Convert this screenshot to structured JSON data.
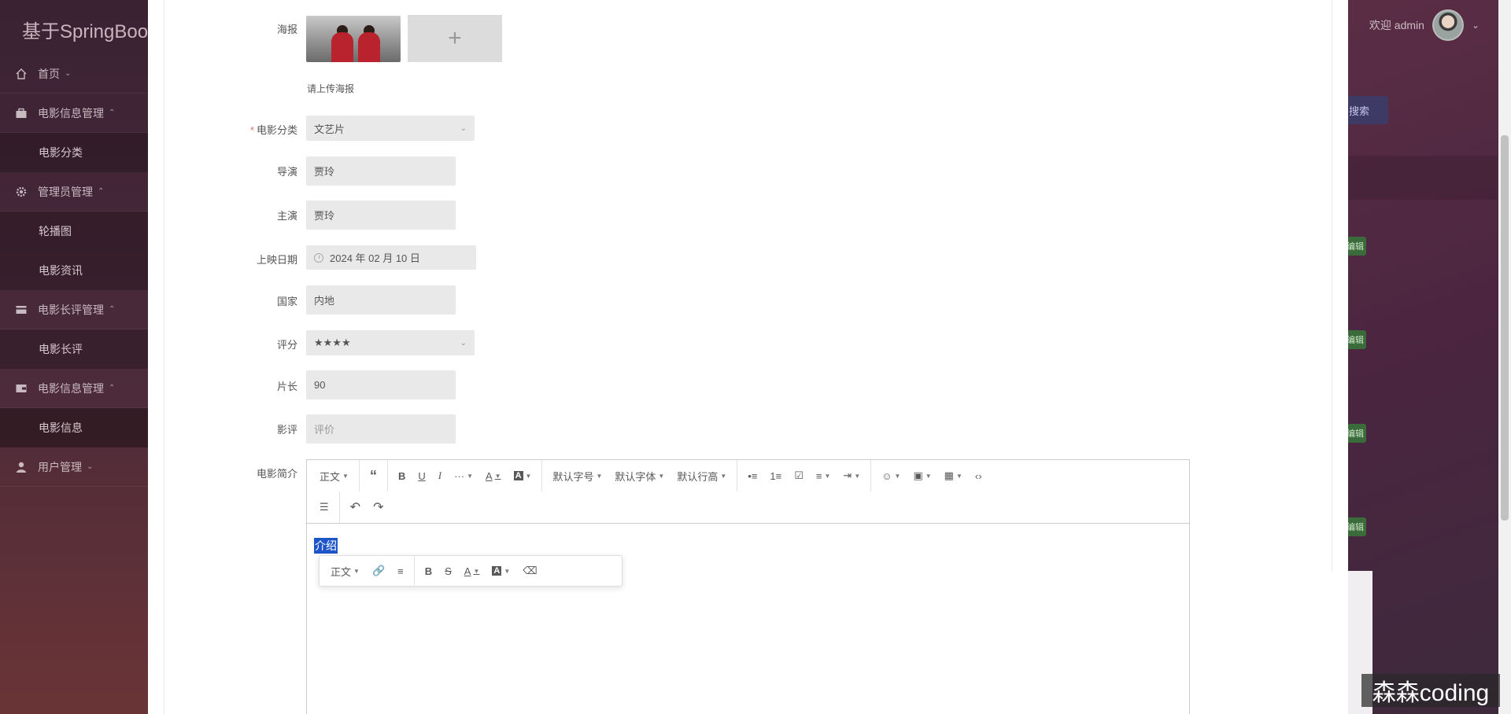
{
  "app": {
    "brand": "基于SpringBoo",
    "welcome": "欢迎 admin",
    "search_btn": "搜索",
    "tag_label": "编辑"
  },
  "sidebar": {
    "items": [
      {
        "label": "首页",
        "icon": "home-icon"
      },
      {
        "label": "电影信息管理",
        "icon": "briefcase-icon"
      },
      {
        "label": "电影分类",
        "sub": true
      },
      {
        "label": "管理员管理",
        "icon": "gear-icon"
      },
      {
        "label": "轮播图",
        "sub": true
      },
      {
        "label": "电影资讯",
        "sub": true
      },
      {
        "label": "电影长评管理",
        "icon": "card-icon"
      },
      {
        "label": "电影长评",
        "sub": true
      },
      {
        "label": "电影信息管理",
        "icon": "wallet-icon"
      },
      {
        "label": "电影信息",
        "sub": true,
        "active": true
      },
      {
        "label": "用户管理",
        "icon": "user-icon"
      }
    ]
  },
  "form": {
    "poster": {
      "label": "海报",
      "hint": "请上传海报",
      "add": "+"
    },
    "category": {
      "label": "电影分类",
      "value": "文艺片",
      "required": true
    },
    "director": {
      "label": "导演",
      "value": "贾玲"
    },
    "lead": {
      "label": "主演",
      "value": "贾玲"
    },
    "release": {
      "label": "上映日期",
      "value": "2024 年 02 月 10 日"
    },
    "country": {
      "label": "国家",
      "value": "内地"
    },
    "rating": {
      "label": "评分",
      "value": "★★★★"
    },
    "duration": {
      "label": "片长",
      "value": "90"
    },
    "review": {
      "label": "影评",
      "placeholder": "评价"
    },
    "intro": {
      "label": "电影简介"
    }
  },
  "editor": {
    "toolbar_row1": [
      "正文",
      "“",
      "B",
      "U",
      "I",
      "···",
      "A",
      "A",
      "默认字号",
      "默认字体",
      "默认行高",
      "•≡",
      "1≡",
      "☑",
      "≡",
      "⇥",
      "☺",
      "▣",
      "▦",
      "‹›"
    ],
    "toolbar_row2": [
      "☰",
      "↶",
      "↷"
    ],
    "content": "介绍",
    "hover_toolbar": [
      "正文",
      "🔗",
      "≡",
      "B",
      "S",
      "A",
      "A",
      "⌫"
    ]
  },
  "watermark": "森森coding"
}
